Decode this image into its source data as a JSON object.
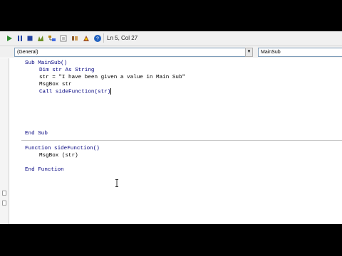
{
  "toolbar": {
    "buttons": [
      {
        "name": "run-icon",
        "color": "#2e8b2e"
      },
      {
        "name": "break-icon",
        "color": "#2040a0"
      },
      {
        "name": "reset-icon",
        "color": "#2040a0"
      },
      {
        "name": "design-mode-icon",
        "color": "#6b8e23"
      },
      {
        "name": "project-explorer-icon",
        "color": "#b8860b"
      },
      {
        "name": "properties-icon",
        "color": "#808080"
      },
      {
        "name": "object-browser-icon",
        "color": "#8b5a2b"
      },
      {
        "name": "toolbox-icon",
        "color": "#a0522d"
      },
      {
        "name": "help-icon",
        "color": "#1e5fbf"
      }
    ],
    "status_text": "Ln 5, Col 27"
  },
  "object_combo": {
    "value": "(General)"
  },
  "procedure_combo": {
    "value": "MainSub"
  },
  "code": {
    "sub_header": "Sub MainSub()",
    "dim_line": "Dim str As String",
    "assign_line": "str = \"I have been given a value in Main Sub\"",
    "msgbox_line": "MsgBox str",
    "call_line": "Call sideFunction(str)",
    "end_sub": "End Sub",
    "function_header": "Function sideFunction()",
    "function_msgbox": "MsgBox (str)",
    "end_function": "End Function"
  },
  "colors": {
    "keyword": "#00007f",
    "text": "#000000",
    "background": "#ffffff"
  }
}
